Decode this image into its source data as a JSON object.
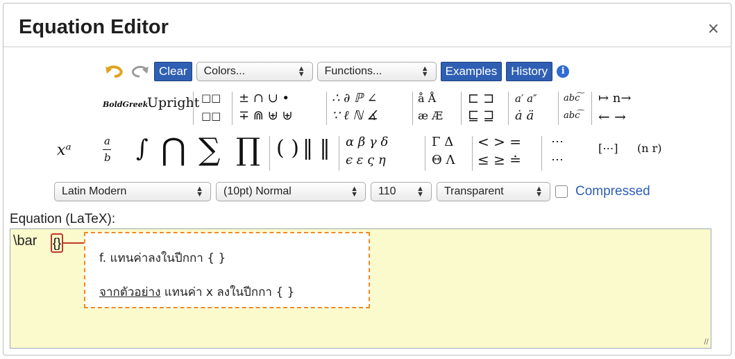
{
  "dialog": {
    "title": "Equation Editor",
    "close_label": "×"
  },
  "toolbar": {
    "undo_icon": "undo-icon",
    "redo_icon": "redo-icon",
    "clear_label": "Clear",
    "colors_label": "Colors...",
    "functions_label": "Functions...",
    "examples_label": "Examples",
    "history_label": "History",
    "info_label": "i"
  },
  "symbols": {
    "boldgreek": "BoldGreek",
    "upright": "Upright",
    "boxes_top": "□□",
    "boxes_bot": "□□",
    "ops_top": "± ∩ ∪ •",
    "ops_bot": "∓ ⋒ ⊎ ⊎",
    "logic_top": "∴ ∂ ℙ ∠",
    "logic_bot": "∵ ℓ ℕ ∡",
    "accent_top": "å Å",
    "accent_bot": "æ Æ",
    "subset_top": "⊏ ⊐",
    "subset_bot": "⊑ ⊒",
    "prime_top": "a′ a″",
    "prime_bot": "ȧ ä",
    "wide_top": "abc͠",
    "wide_bot": "abc͡",
    "arrow_top": "↦ n→",
    "arrow_bot": "← →",
    "pow": "xᵃ",
    "frac_num": "a",
    "frac_den": "b",
    "integral": "∫",
    "bigcap": "⋂",
    "sum": "∑",
    "prod": "∏",
    "paren": "( )",
    "norm": "‖ ‖",
    "greek_top": "α β γ δ",
    "greek_bot": "ϵ ε ς η",
    "cap_greek_top": "Γ Δ",
    "cap_greek_bot": "Θ Λ",
    "rel_top": "< > =",
    "rel_bot": "≤ ≥ ≐",
    "dots_top": "⋯",
    "dots_bot": "⋯",
    "matrix": "[⋯]",
    "binom": "(n r)"
  },
  "options": {
    "font": "Latin Modern",
    "size": "(10pt) Normal",
    "dpi": "110",
    "background": "Transparent",
    "compressed_label": "Compressed"
  },
  "editor": {
    "label": "Equation (LaTeX):",
    "latex_text": "\\bar",
    "brace_text": "{}"
  },
  "callout": {
    "line1": "f. แทนค่าลงในปีกกา { }",
    "line2_underlined": "จากตัวอย่าง",
    "line2_rest": " แทนค่า x ลงในปีกกา { }"
  },
  "colors": {
    "accent": "#2f5fb3",
    "editor_bg": "#fafacd",
    "callout_border": "#f08a24",
    "highlight": "#c0392b"
  }
}
